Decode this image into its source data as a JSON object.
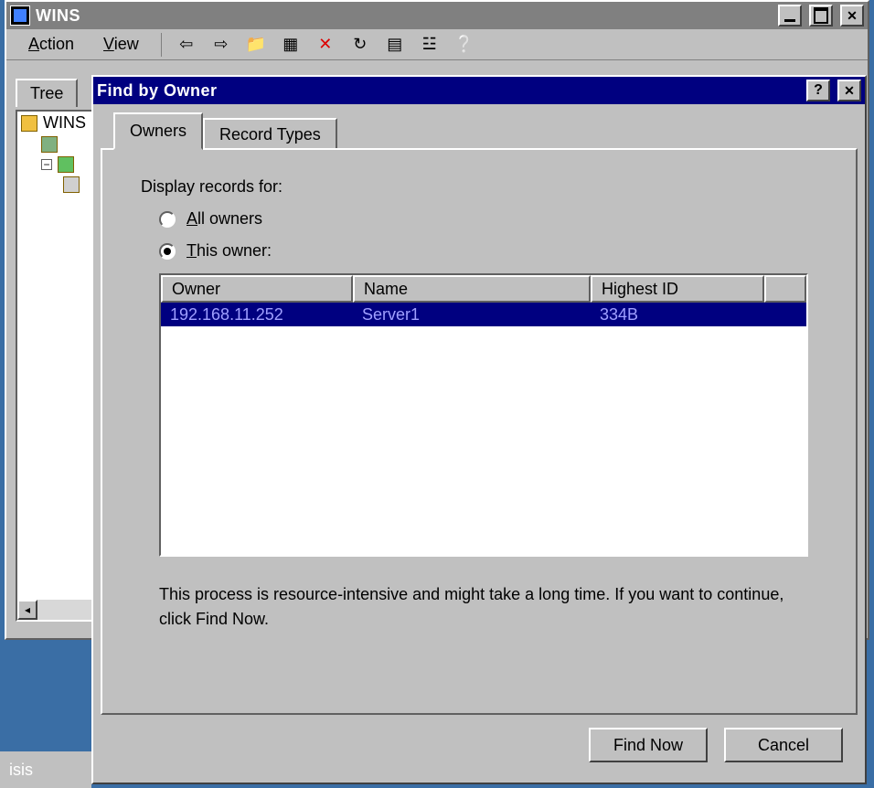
{
  "main_window": {
    "title": "WINS",
    "menus": {
      "action": "Action",
      "view": "View"
    },
    "tree_tab": "Tree",
    "tree_root": "WINS"
  },
  "dialog": {
    "title": "Find by Owner",
    "tabs": {
      "owners": "Owners",
      "record_types": "Record Types"
    },
    "display_label": "Display records for:",
    "radio_all": "All owners",
    "radio_this": "This owner:",
    "columns": {
      "owner": "Owner",
      "name": "Name",
      "highest_id": "Highest ID"
    },
    "rows": [
      {
        "owner": "192.168.11.252",
        "name": "Server1",
        "highest_id": "334B"
      }
    ],
    "warning": "This process is resource-intensive and might take a long time.  If you want to continue, click Find Now.",
    "buttons": {
      "find_now": "Find Now",
      "cancel": "Cancel"
    }
  },
  "taskbar_item": "isis"
}
